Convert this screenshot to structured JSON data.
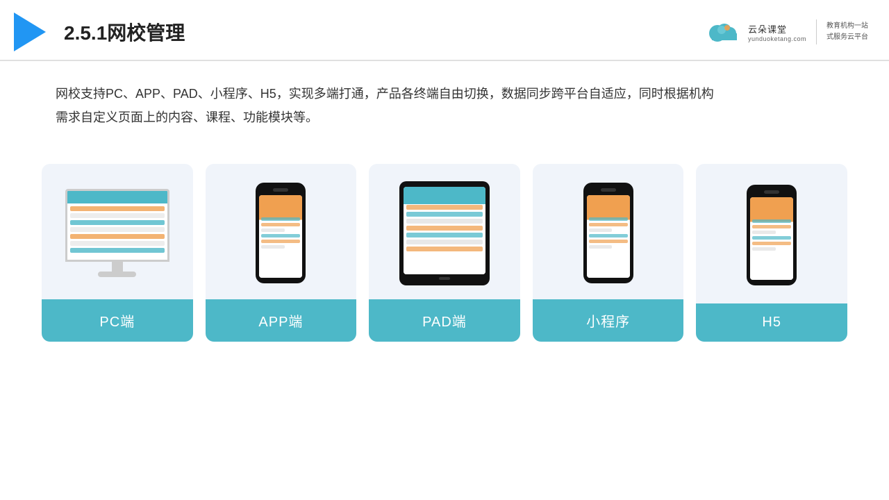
{
  "header": {
    "title": "2.5.1网校管理",
    "logo": {
      "main_text": "云朵课堂",
      "sub_text": "yunduoketang.com",
      "slogan_line1": "教育机构一站",
      "slogan_line2": "式服务云平台"
    }
  },
  "description": {
    "text_line1": "网校支持PC、APP、PAD、小程序、H5，实现多端打通，产品各终端自由切换，数据同步跨平台自适应，同时根据机构",
    "text_line2": "需求自定义页面上的内容、课程、功能模块等。"
  },
  "cards": [
    {
      "id": "pc",
      "label": "PC端"
    },
    {
      "id": "app",
      "label": "APP端"
    },
    {
      "id": "pad",
      "label": "PAD端"
    },
    {
      "id": "miniprogram",
      "label": "小程序"
    },
    {
      "id": "h5",
      "label": "H5"
    }
  ]
}
